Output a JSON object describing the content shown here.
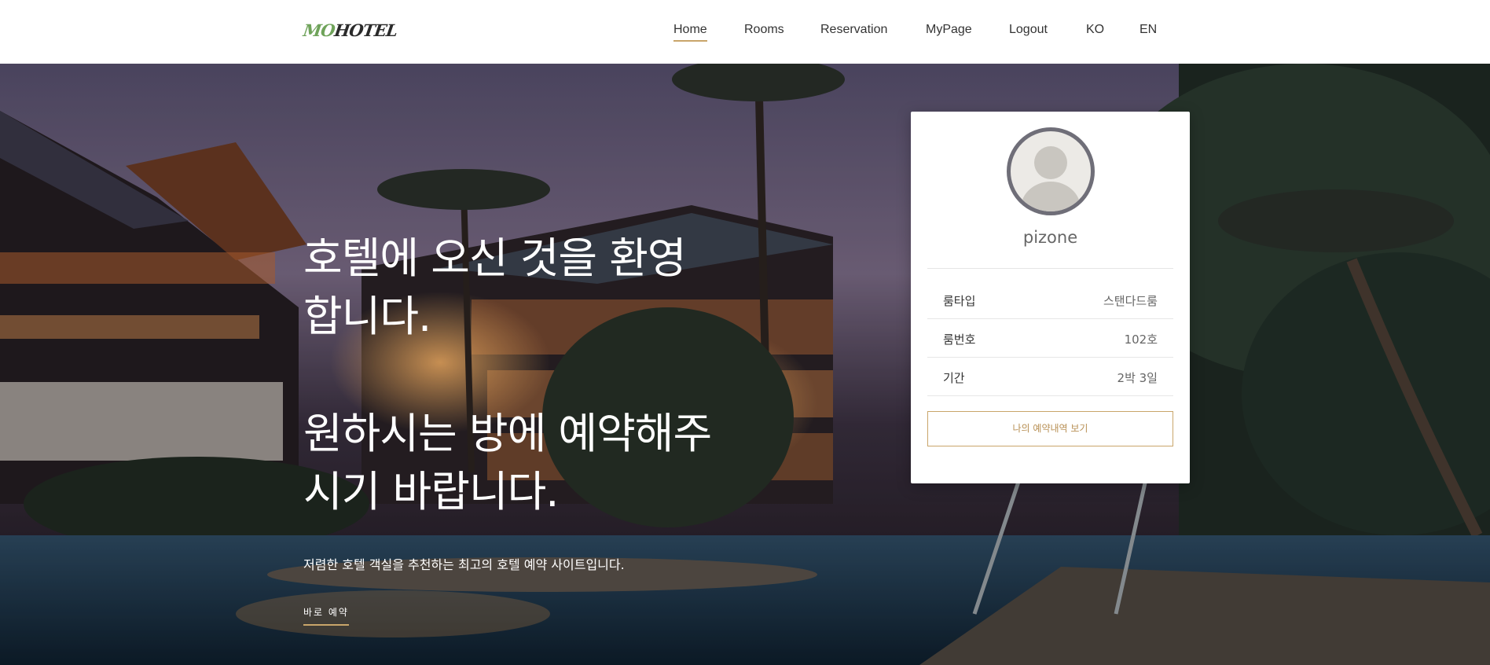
{
  "header": {
    "logo": {
      "part1": "MO",
      "part2": "HOTEL"
    },
    "nav": [
      {
        "label": "Home",
        "active": true
      },
      {
        "label": "Rooms"
      },
      {
        "label": "Reservation"
      },
      {
        "label": "MyPage"
      },
      {
        "label": "Logout"
      },
      {
        "label": "KO"
      },
      {
        "label": "EN"
      }
    ],
    "accent_color": "#c9a56a"
  },
  "hero": {
    "title_line1": "호텔에 오신 것을 환영",
    "title_line2": "합니다.",
    "title_line3": "원하시는 방에 예약해주",
    "title_line4": "시기 바랍니다.",
    "subtitle": "저렴한 호텔 객실을 추천하는 최고의 호텔 예약 사이트입니다.",
    "cta_label": "바로 예약"
  },
  "profile": {
    "avatar_icon": "user-avatar-icon",
    "username": "pizone",
    "rows": [
      {
        "key": "룸타입",
        "value": "스탠다드룸"
      },
      {
        "key": "룸번호",
        "value": "102호"
      },
      {
        "key": "기간",
        "value": "2박 3일"
      }
    ],
    "button_label": "나의 예약내역 보기"
  }
}
